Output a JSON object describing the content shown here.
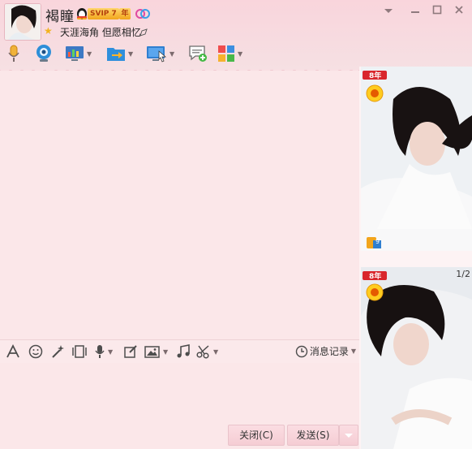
{
  "contact": {
    "name": "褐瞳",
    "vip_label": "SVIP 7",
    "year_label": "年",
    "signature": "天涯海角 但愿相忆"
  },
  "window_controls": {
    "dropdown_icon": "chevron-down-icon",
    "minimize_icon": "minimize-icon",
    "maximize_icon": "maximize-icon",
    "close_icon": "close-icon"
  },
  "top_toolbar": [
    {
      "name": "voice-call-button",
      "icon": "microphone-icon"
    },
    {
      "name": "video-call-button",
      "icon": "webcam-icon"
    },
    {
      "name": "remote-assist-button",
      "icon": "screen-icon"
    },
    {
      "name": "file-transfer-button",
      "icon": "folder-arrow-icon"
    },
    {
      "name": "share-screen-button",
      "icon": "monitor-cursor-icon"
    },
    {
      "name": "new-discussion-button",
      "icon": "chat-add-icon"
    },
    {
      "name": "apps-button",
      "icon": "apps-grid-icon"
    }
  ],
  "input_toolbar": {
    "history_label": "消息记录"
  },
  "buttons": {
    "close_label": "关闭(C)",
    "send_label": "发送(S)"
  },
  "side_panel": {
    "ribbon_label": "8年",
    "photo_counter": "1/2",
    "level_badge_text": "9"
  },
  "colors": {
    "theme_pink": "#f9d5dc",
    "chat_bg": "#fbe7e9",
    "vip_gold": "#f2a51c"
  }
}
